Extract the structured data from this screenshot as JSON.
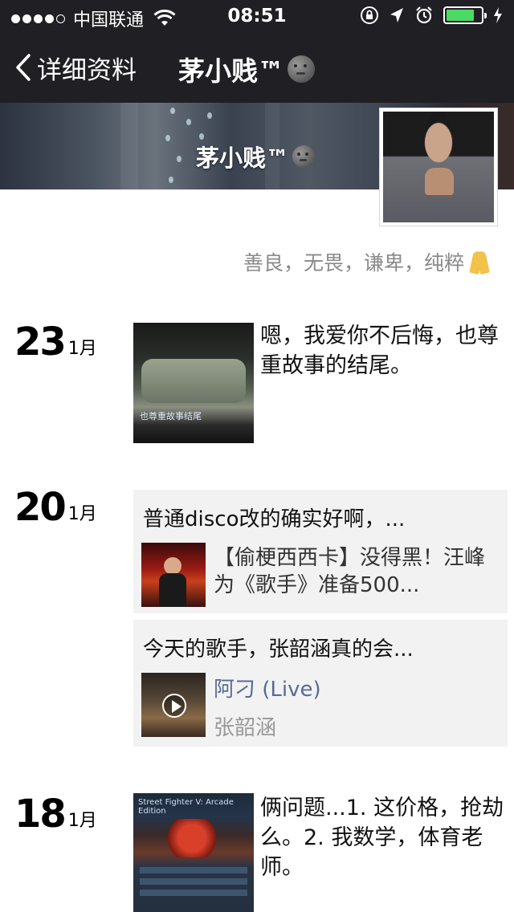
{
  "status_bar": {
    "carrier": "中国联通",
    "time": "08:51",
    "battery_level": 0.8,
    "icons": [
      "signal-dots-icon",
      "wifi-icon",
      "rotation-lock-icon",
      "location-arrow-icon",
      "alarm-icon",
      "battery-icon",
      "charging-bolt-icon"
    ]
  },
  "nav": {
    "back_label": "详细资料",
    "title": "茅小贱™"
  },
  "profile": {
    "cover_name": "茅小贱™",
    "signature": "善良，无畏，谦卑，纯粹"
  },
  "posts": [
    {
      "day": "23",
      "month": "1月",
      "text": "嗯，我爱你不后悔，也尊重故事的结尾。",
      "image_subtitle": "也尊重故事结尾"
    },
    {
      "day": "20",
      "month": "1月",
      "shares": [
        {
          "caption": "普通disco改的确实好啊，...",
          "title": "【偷梗西西卡】没得黑！汪峰为《歌手》准备500...",
          "type": "article"
        },
        {
          "caption": "今天的歌手，张韶涵真的会...",
          "title": "阿刁 (Live)",
          "artist": "张韶涵",
          "type": "music"
        }
      ]
    },
    {
      "day": "18",
      "month": "1月",
      "text": "俩问题...1. 这价格，抢劫么。2. 我数学，体育老师。",
      "image_header": "Street Fighter V: Arcade Edition"
    }
  ],
  "colors": {
    "nav_bg": "#1f1f24",
    "share_bg": "#f2f2f2",
    "link_blue": "#586b95",
    "battery_green": "#4cd964"
  }
}
